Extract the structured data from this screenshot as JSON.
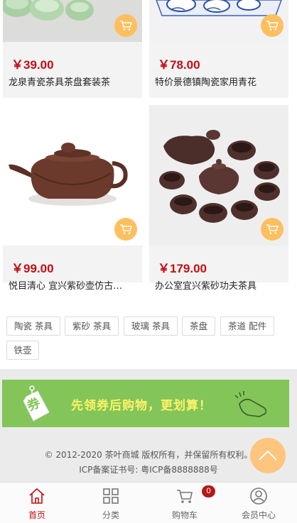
{
  "products": [
    {
      "price": "￥39.00",
      "title": "龙泉青瓷茶具茶盘套装茶",
      "image": "celadon-tea-cups"
    },
    {
      "price": "￥78.00",
      "title": "特价景德镇陶瓷家用青花",
      "image": "blue-white-porcelain"
    },
    {
      "price": "￥99.00",
      "title": "悦目清心 宜兴紫砂壶仿古…",
      "image": "purple-clay-teapot"
    },
    {
      "price": "￥179.00",
      "title": "办公室宜兴紫砂功夫茶具",
      "image": "purple-clay-tea-set"
    }
  ],
  "tags": [
    "陶瓷 茶具",
    "紫砂 茶具",
    "玻璃 茶具",
    "茶盘",
    "茶道 配件",
    "铁壶"
  ],
  "banner": {
    "badge": "券",
    "text": "先领券后购物，更划算！"
  },
  "footer": {
    "copyright": "© 2012-2020 茶叶商城 版权所有，并保留所有权利。",
    "icp": "ICP备案证书号: 粤ICP备8888888号"
  },
  "tabbar": {
    "items": [
      {
        "label": "首页",
        "icon": "home-icon"
      },
      {
        "label": "分类",
        "icon": "category-icon"
      },
      {
        "label": "购物车",
        "icon": "cart-icon"
      },
      {
        "label": "会员中心",
        "icon": "user-icon"
      }
    ],
    "cart_count": "0"
  },
  "colors": {
    "price": "#c30d13",
    "cart_button": "#fdbf5f",
    "banner": "#83c558",
    "active_tab": "#c30d13"
  }
}
